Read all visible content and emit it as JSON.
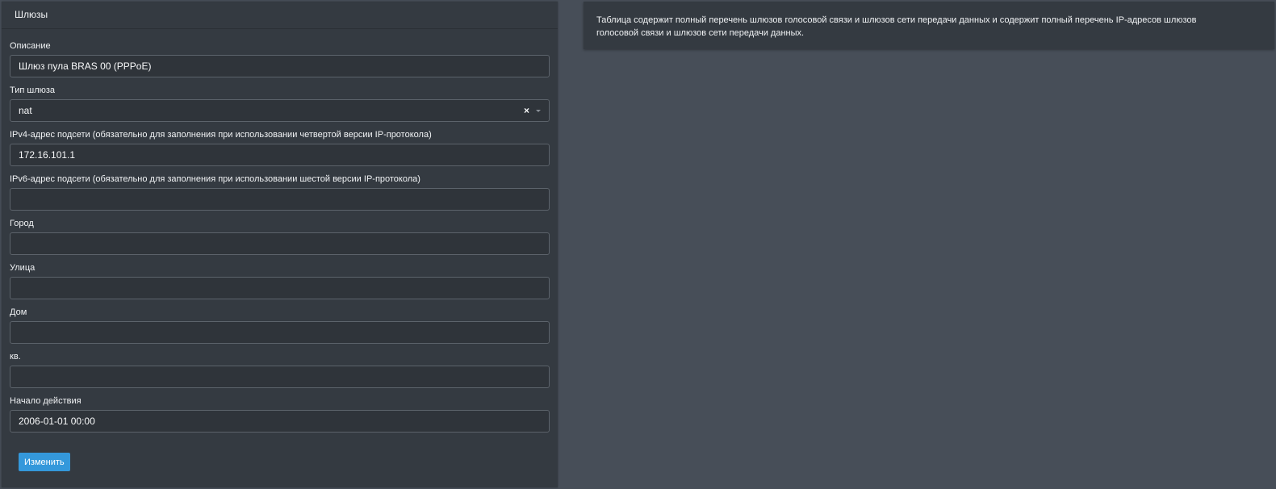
{
  "panel": {
    "title": "Шлюзы"
  },
  "form": {
    "description": {
      "label": "Описание",
      "value": "Шлюз пула BRAS 00 (PPPoE)"
    },
    "gateway_type": {
      "label": "Тип шлюза",
      "value": "nat",
      "clear": "×"
    },
    "ipv4": {
      "label": "IPv4-адрес подсети (обязательно для заполнения при использовании четвертой версии IP-протокола)",
      "value": "172.16.101.1"
    },
    "ipv6": {
      "label": "IPv6-адрес подсети (обязательно для заполнения при использовании шестой версии IP-протокола)",
      "value": ""
    },
    "city": {
      "label": "Город",
      "value": ""
    },
    "street": {
      "label": "Улица",
      "value": ""
    },
    "house": {
      "label": "Дом",
      "value": ""
    },
    "apartment": {
      "label": "кв.",
      "value": ""
    },
    "start_date": {
      "label": "Начало действия",
      "value": "2006-01-01 00:00"
    },
    "submit_label": "Изменить"
  },
  "info": {
    "text": "Таблица содержит полный перечень шлюзов голосовой связи и шлюзов сети передачи данных и содержит полный перечень IP-адресов шлюзов голосовой связи и шлюзов сети передачи данных."
  },
  "colors": {
    "accent": "#3498db",
    "panel": "#343a41",
    "background": "#474e58"
  }
}
